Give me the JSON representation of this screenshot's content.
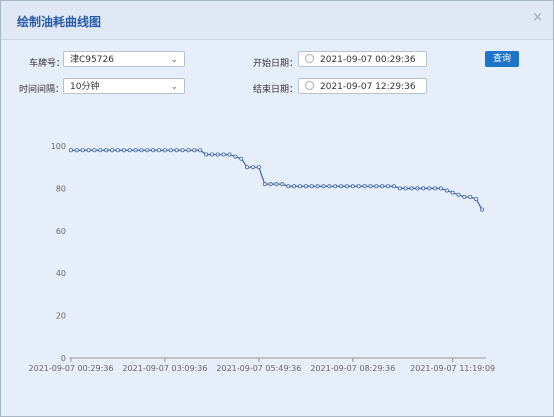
{
  "dialog": {
    "title": "绘制油耗曲线图",
    "close_label": "×"
  },
  "form": {
    "plate_label": "车牌号：",
    "plate_value": "津C95726",
    "interval_label": "时间间隔：",
    "interval_value": "10分钟",
    "start_label": "开始日期：",
    "start_value": "2021-09-07 00:29:36",
    "end_label": "结束日期：",
    "end_value": "2021-09-07 12:29:36",
    "query_label": "查询",
    "caret": "⌄"
  },
  "chart_data": {
    "type": "line",
    "title": "",
    "xlabel": "",
    "ylabel": "",
    "ylim": [
      0,
      100
    ],
    "yticks": [
      0,
      20,
      40,
      60,
      80,
      100
    ],
    "xtick_labels": [
      "2021-09-07 00:29:36",
      "2021-09-07 03:09:36",
      "2021-09-07 05:49:36",
      "2021-09-07 08:29:36",
      "2021-09-07 11:19:09"
    ],
    "xtick_indices": [
      0,
      16,
      32,
      48,
      65
    ],
    "color": "#3b64a8",
    "values": [
      98,
      98,
      98,
      98,
      98,
      98,
      98,
      98,
      98,
      98,
      98,
      98,
      98,
      98,
      98,
      98,
      98,
      98,
      98,
      98,
      98,
      98,
      98,
      96,
      96,
      96,
      96,
      96,
      95,
      94,
      90,
      90,
      90,
      82,
      82,
      82,
      82,
      81,
      81,
      81,
      81,
      81,
      81,
      81,
      81,
      81,
      81,
      81,
      81,
      81,
      81,
      81,
      81,
      81,
      81,
      81,
      80,
      80,
      80,
      80,
      80,
      80,
      80,
      80,
      79,
      78,
      77,
      76,
      76,
      75,
      70
    ]
  }
}
